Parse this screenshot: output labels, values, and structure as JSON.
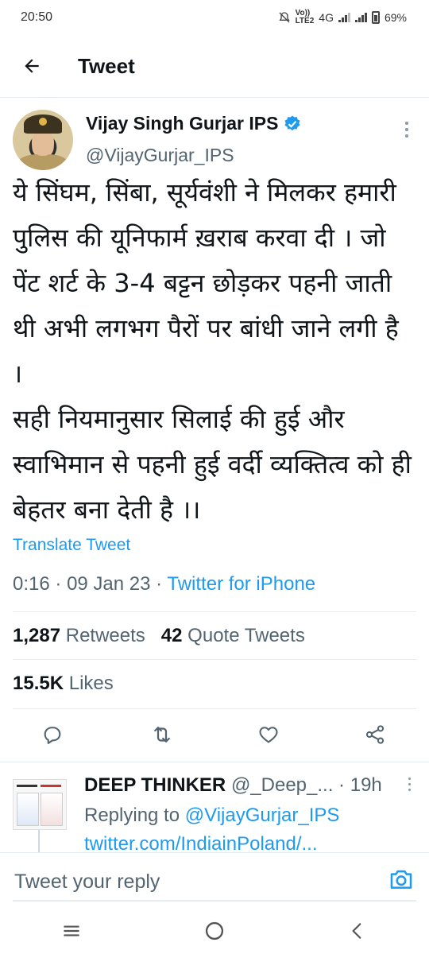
{
  "status_bar": {
    "time": "20:50",
    "volte_top": "Vo))",
    "volte_bottom": "LTE2",
    "network": "4G",
    "battery": "69%"
  },
  "header": {
    "back_icon": "arrow-left-icon",
    "title": "Tweet"
  },
  "tweet": {
    "author_name": "Vijay Singh Gurjar IPS",
    "author_handle": "@VijayGurjar_IPS",
    "text": "ये सिंघम, सिंबा, सूर्यवंशी ने मिलकर हमारी पुलिस की यूनिफार्म ख़राब करवा दी । जो पेंट शर्ट के 3-4 बट्टन छोड़कर पहनी जाती थी अभी लगभग पैरों पर बांधी जाने लगी है ।\nसही नियमानुसार सिलाई की हुई और स्वाभिमान से पहनी हुई वर्दी व्यक्तित्व को ही बेहतर बना देती है ।।",
    "translate_label": "Translate Tweet",
    "time": "0:16",
    "date": "09 Jan 23",
    "source": "Twitter for iPhone",
    "retweets_count": "1,287",
    "retweets_label": "Retweets",
    "quotes_count": "42",
    "quotes_label": "Quote Tweets",
    "likes_count": "15.5K",
    "likes_label": "Likes"
  },
  "actions": [
    "reply-icon",
    "retweet-icon",
    "like-icon",
    "share-icon"
  ],
  "reply": {
    "name": "DEEP THINKER",
    "handle": "@_Deep_...",
    "time_ago": "19h",
    "replying_prefix": "Replying to",
    "replying_to": "@VijayGurjar_IPS",
    "link": "twitter.com/IndiainPoland/..."
  },
  "composer": {
    "placeholder": "Tweet your reply",
    "camera_icon": "camera-icon"
  },
  "colors": {
    "accent": "#1d9bf0",
    "secondary_text": "#536471"
  }
}
